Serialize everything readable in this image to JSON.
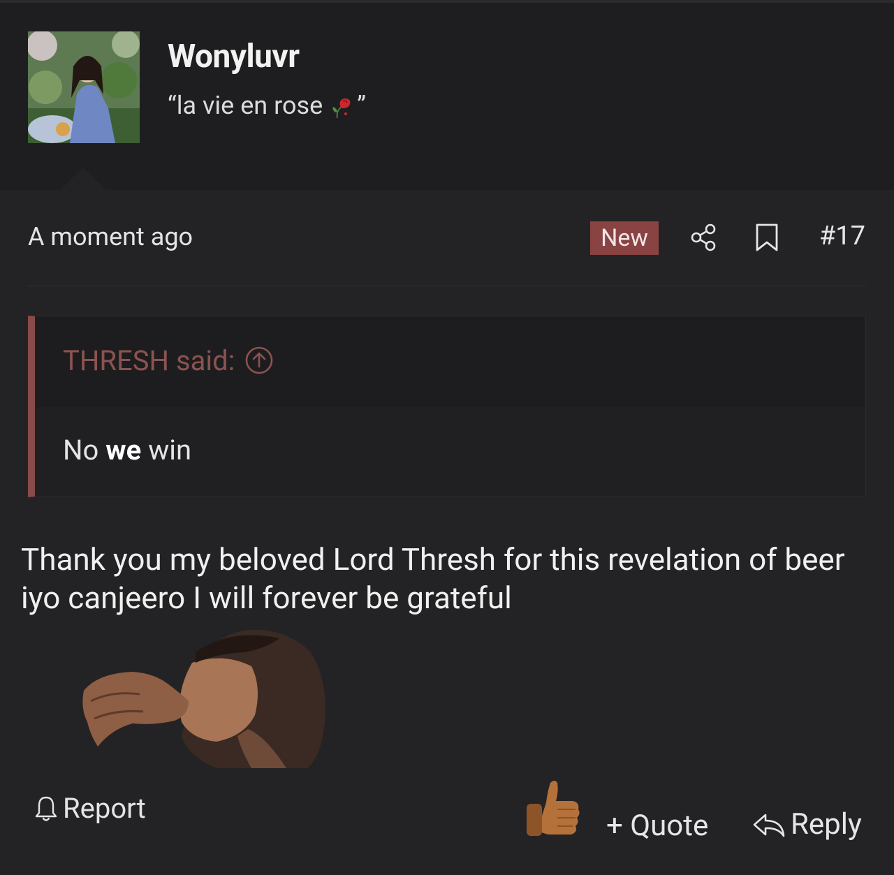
{
  "user": {
    "name": "Wonyluvr",
    "title_prefix": "“la vie en rose ",
    "title_suffix": "”"
  },
  "post": {
    "timestamp": "A moment ago",
    "badge": "New",
    "number": "#17",
    "quote": {
      "author_label": "THRESH said:",
      "text_before": "No ",
      "text_bold": "we",
      "text_after": " win"
    },
    "message": "Thank you my beloved Lord Thresh for this revelation of beer iyo canjeero I will forever be grateful"
  },
  "actions": {
    "report": "Report",
    "quote": "+ Quote",
    "reply": "Reply"
  },
  "colors": {
    "accent": "#8a4343",
    "quote_author": "#8b5350",
    "background": "#232325"
  },
  "icons": [
    "rose-icon",
    "share-icon",
    "bookmark-icon",
    "arrow-up-circle-icon",
    "bell-icon",
    "thumbs-up-icon",
    "reply-arrow-icon"
  ]
}
